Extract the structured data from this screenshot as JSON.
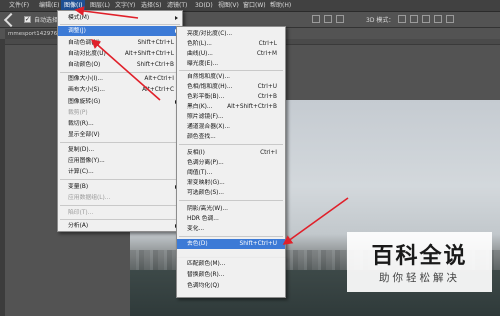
{
  "menubar": {
    "items": [
      "文件(F)",
      "编辑(E)",
      "图像(I)",
      "图层(L)",
      "文字(Y)",
      "选择(S)",
      "滤镜(T)",
      "3D(D)",
      "视图(V)",
      "窗口(W)",
      "帮助(H)"
    ],
    "active_index": 2
  },
  "optionsbar": {
    "auto_select_label": "自动选择：",
    "mode_3d_label": "3D 模式："
  },
  "document": {
    "tab_title": "mmesport1429762"
  },
  "image_menu": {
    "items": [
      {
        "label": "模式(M)",
        "shortcut": "",
        "submenu": true,
        "disabled": false
      },
      {
        "label": "调整(J)",
        "shortcut": "",
        "submenu": true,
        "disabled": false,
        "highlighted": true
      },
      {
        "label": "自动色调(N)",
        "shortcut": "Shift+Ctrl+L",
        "disabled": false
      },
      {
        "label": "自动对比度(U)",
        "shortcut": "Alt+Shift+Ctrl+L",
        "disabled": false
      },
      {
        "label": "自动颜色(O)",
        "shortcut": "Shift+Ctrl+B",
        "disabled": false
      },
      {
        "label": "图像大小(I)...",
        "shortcut": "Alt+Ctrl+I",
        "disabled": false
      },
      {
        "label": "画布大小(S)...",
        "shortcut": "Alt+Ctrl+C",
        "disabled": false
      },
      {
        "label": "图像旋转(G)",
        "shortcut": "",
        "submenu": true,
        "disabled": false
      },
      {
        "label": "裁剪(P)",
        "shortcut": "",
        "disabled": true
      },
      {
        "label": "裁切(R)...",
        "shortcut": "",
        "disabled": false
      },
      {
        "label": "显示全部(V)",
        "shortcut": "",
        "disabled": false
      },
      {
        "label": "复制(D)...",
        "shortcut": "",
        "disabled": false
      },
      {
        "label": "应用图像(Y)...",
        "shortcut": "",
        "disabled": false
      },
      {
        "label": "计算(C)...",
        "shortcut": "",
        "disabled": false
      },
      {
        "label": "变量(B)",
        "shortcut": "",
        "submenu": true,
        "disabled": false
      },
      {
        "label": "应用数据组(L)...",
        "shortcut": "",
        "disabled": true
      },
      {
        "label": "陷印(T)...",
        "shortcut": "",
        "disabled": true
      },
      {
        "label": "分析(A)",
        "shortcut": "",
        "submenu": true,
        "disabled": false
      }
    ]
  },
  "adjust_menu": {
    "items": [
      {
        "label": "亮度/对比度(C)...",
        "shortcut": ""
      },
      {
        "label": "色阶(L)...",
        "shortcut": "Ctrl+L"
      },
      {
        "label": "曲线(U)...",
        "shortcut": "Ctrl+M"
      },
      {
        "label": "曝光度(E)...",
        "shortcut": ""
      },
      {
        "label": "自然饱和度(V)...",
        "shortcut": ""
      },
      {
        "label": "色相/饱和度(H)...",
        "shortcut": "Ctrl+U"
      },
      {
        "label": "色彩平衡(B)...",
        "shortcut": "Ctrl+B"
      },
      {
        "label": "黑白(K)...",
        "shortcut": "Alt+Shift+Ctrl+B"
      },
      {
        "label": "照片滤镜(F)...",
        "shortcut": ""
      },
      {
        "label": "通道混合器(X)...",
        "shortcut": ""
      },
      {
        "label": "颜色查找...",
        "shortcut": ""
      },
      {
        "label": "反相(I)",
        "shortcut": "Ctrl+I"
      },
      {
        "label": "色调分离(P)...",
        "shortcut": ""
      },
      {
        "label": "阈值(T)...",
        "shortcut": ""
      },
      {
        "label": "渐变映射(G)...",
        "shortcut": ""
      },
      {
        "label": "可选颜色(S)...",
        "shortcut": ""
      },
      {
        "label": "阴影/高光(W)...",
        "shortcut": ""
      },
      {
        "label": "HDR 色调...",
        "shortcut": ""
      },
      {
        "label": "变化...",
        "shortcut": ""
      },
      {
        "label": "去色(D)",
        "shortcut": "Shift+Ctrl+U",
        "highlighted": true
      },
      {
        "label": "匹配颜色(M)...",
        "shortcut": ""
      },
      {
        "label": "替换颜色(R)...",
        "shortcut": ""
      },
      {
        "label": "色调均化(Q)",
        "shortcut": ""
      }
    ]
  },
  "watermark": {
    "title": "百科全说",
    "subtitle": "助你轻松解决"
  },
  "colors": {
    "highlight": "#3c7ad6",
    "annotation_arrow": "#e0202a",
    "menubar_active": "#1e4f93"
  }
}
